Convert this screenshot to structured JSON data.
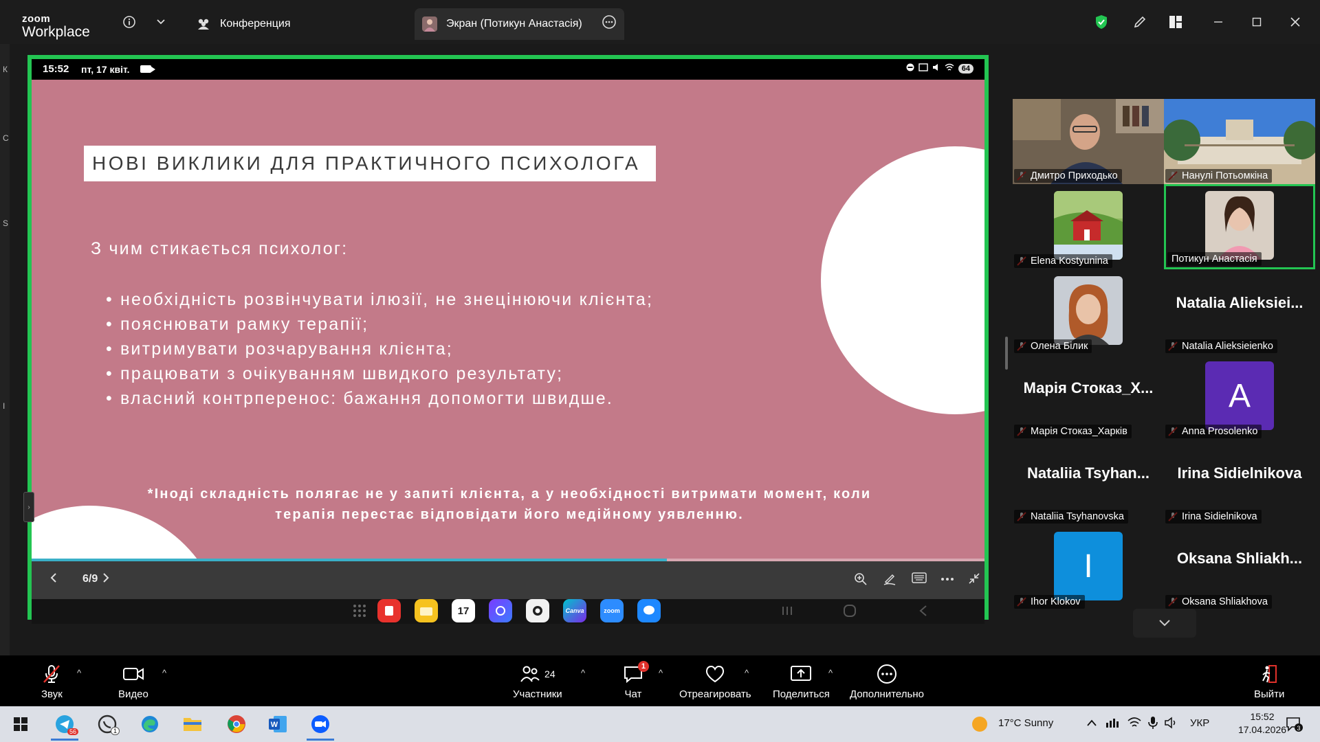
{
  "titlebar": {
    "brand_small": "zoom",
    "brand_large": "Workplace",
    "tab_meeting": "Конференция",
    "tab_screen": "Экран (Потикун Анастасія)",
    "icons": [
      "info-icon",
      "chevron-down-icon",
      "shield-check-icon",
      "pen-icon",
      "layout-icon",
      "minimize-icon",
      "maximize-icon",
      "close-icon"
    ]
  },
  "left_strip": [
    "К",
    "С",
    "S",
    "І"
  ],
  "shared_screen": {
    "status": {
      "time": "15:52",
      "date": "пт, 17 квіт.",
      "battery": "64"
    },
    "slide": {
      "title": "НОВІ ВИКЛИКИ ДЛЯ ПРАКТИЧНОГО ПСИХОЛОГА",
      "subtitle": "З чим стикається психолог:",
      "bullets": [
        "необхідність розвінчувати ілюзії, не знецінюючи клієнта;",
        "пояснювати рамку терапії;",
        "витримувати розчарування клієнта;",
        "працювати з очікуванням швидкого результату;",
        "власний контрперенос: бажання допомогти швидше."
      ],
      "footnote_line1": "*Іноді складність полягає не у запиті клієнта, а у необхідності витримати момент, коли",
      "footnote_line2": "терапія перестає відповідати його медійному уявленню.",
      "bg_color": "#c37a89"
    },
    "progress": 0.667,
    "pager": "6/9",
    "dock_apps": [
      {
        "name": "app-grid",
        "label": ""
      },
      {
        "name": "notes-red",
        "label": ""
      },
      {
        "name": "files-yellow",
        "label": ""
      },
      {
        "name": "calendar",
        "label": "17"
      },
      {
        "name": "purple-app",
        "label": ""
      },
      {
        "name": "camera",
        "label": ""
      },
      {
        "name": "canva",
        "label": "Canva"
      },
      {
        "name": "zoom",
        "label": "zoom"
      },
      {
        "name": "messages",
        "label": ""
      }
    ]
  },
  "participants": [
    {
      "name": "Дмитро Приходько",
      "type": "video"
    },
    {
      "name": "Нанулі Потьомкіна",
      "type": "video"
    },
    {
      "name": "Elena Kostyunina",
      "type": "photo"
    },
    {
      "name": "Потикун Анастасія",
      "type": "photo",
      "active_speaker": true
    },
    {
      "name": "Олена Білик",
      "type": "photo"
    },
    {
      "name": "Natalia Alieksieienko",
      "type": "text",
      "big": "Natalia  Alieksiei..."
    },
    {
      "name": "Марія Стоказ_Харків",
      "type": "text",
      "big": "Марія Стоказ_Х..."
    },
    {
      "name": "Anna Prosolenko",
      "type": "avatar",
      "letter": "A",
      "color": "#5b2bb3"
    },
    {
      "name": "Nataliia Tsyhanovska",
      "type": "text",
      "big": "Nataliia  Tsyhan..."
    },
    {
      "name": "Irina Sidielnikova",
      "type": "text",
      "big": "Irina Sidielnikova"
    },
    {
      "name": "Ihor Klokov",
      "type": "avatar",
      "letter": "I",
      "color": "#0e8fdc"
    },
    {
      "name": "Oksana Shliakhova",
      "type": "text",
      "big": "Oksana  Shliakh..."
    }
  ],
  "toolbar": {
    "audio": "Звук",
    "video": "Видео",
    "participants": "Участники",
    "participants_count": "24",
    "chat": "Чат",
    "chat_badge": "1",
    "react": "Отреагировать",
    "share": "Поделиться",
    "more": "Дополнительно",
    "leave": "Выйти"
  },
  "taskbar": {
    "telegram_badge": "56",
    "whatsapp_badge": "1",
    "weather": "17°C  Sunny",
    "lang": "УКР",
    "clock_time": "15:52",
    "clock_date": "17.04.2026"
  }
}
